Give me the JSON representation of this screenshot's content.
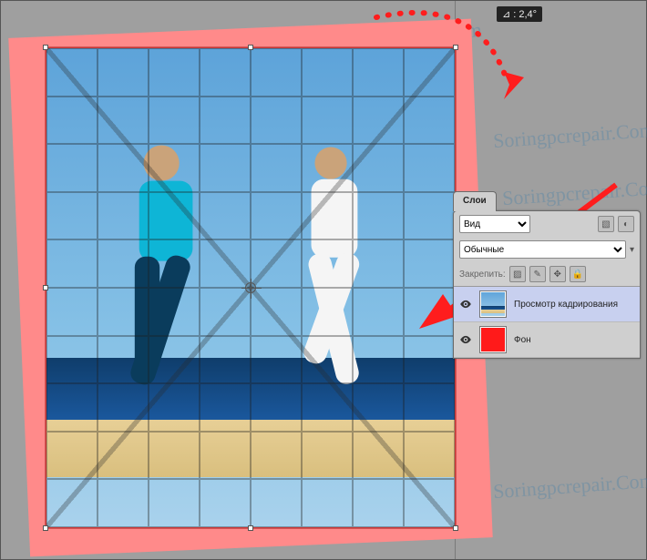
{
  "canvas": {
    "rotation_label": "⊿ :  2,4°",
    "rotation_deg": 2.4
  },
  "panel": {
    "tab_label": "Слои",
    "kind_label": "Вид",
    "kind_options": [
      "Вид"
    ],
    "blend_label": "Обычные",
    "blend_options": [
      "Обычные"
    ],
    "lock_label": "Закрепить:"
  },
  "layers": [
    {
      "name": "Просмотр кадрирования",
      "active": true,
      "visible": true,
      "thumb": "photo"
    },
    {
      "name": "Фон",
      "active": false,
      "visible": true,
      "thumb": "fill"
    }
  ],
  "watermark_text": "Soringpcrepair.Com"
}
